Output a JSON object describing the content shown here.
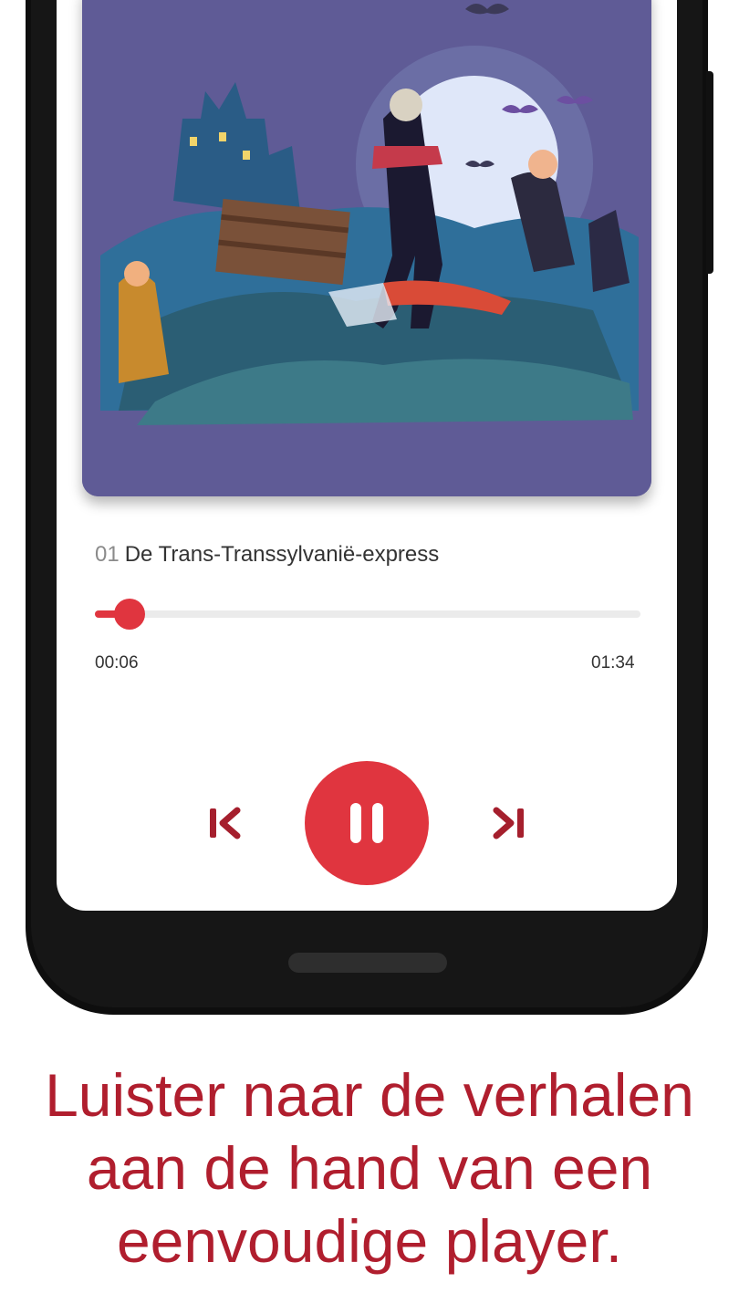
{
  "player": {
    "track_number": "01",
    "track_title": "De Trans-Transsylvanië-express",
    "elapsed": "00:06",
    "total": "01:34",
    "progress_fraction": 0.064,
    "accent_color": "#e0353f",
    "controls": {
      "previous_icon": "skip-previous-icon",
      "play_pause_icon": "pause-icon",
      "next_icon": "skip-next-icon"
    }
  },
  "caption": {
    "line1": "Luister naar de verhalen",
    "line2": "aan de hand van een",
    "line3": "eenvoudige player.",
    "color": "#b01e2e"
  }
}
